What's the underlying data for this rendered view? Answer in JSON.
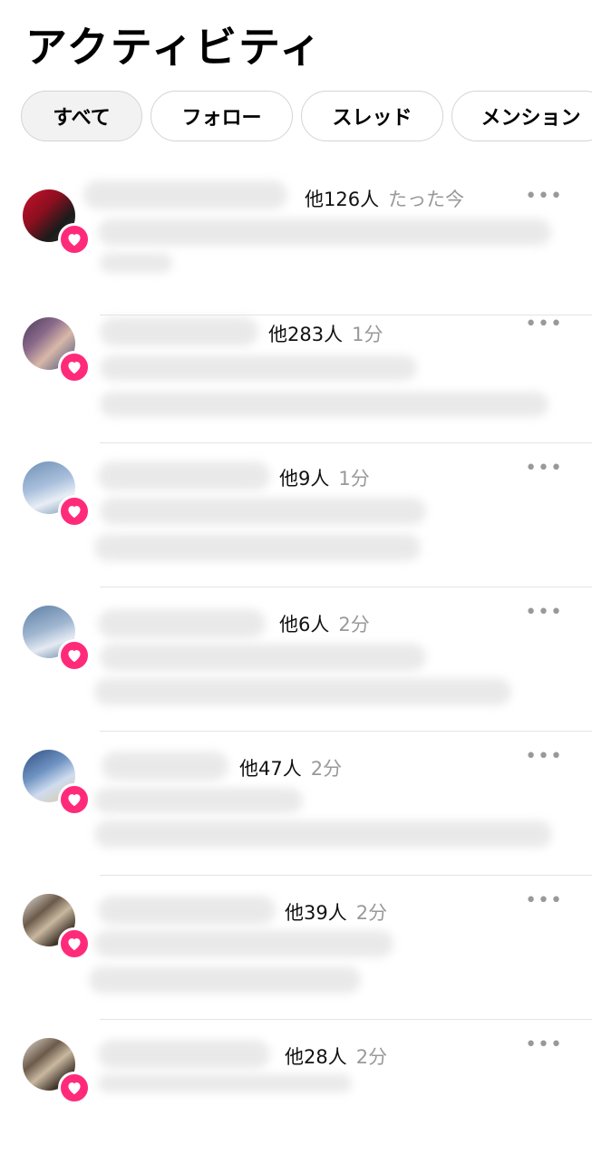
{
  "title": "アクティビティ",
  "tabs": [
    {
      "label": "すべて",
      "active": true
    },
    {
      "label": "フォロー",
      "active": false
    },
    {
      "label": "スレッド",
      "active": false
    },
    {
      "label": "メンション",
      "active": false
    }
  ],
  "notifications": [
    {
      "others": "他126人",
      "time": "たった今",
      "icon": "heart-icon"
    },
    {
      "others": "他283人",
      "time": "1分",
      "icon": "heart-icon"
    },
    {
      "others": "他9人",
      "time": "1分",
      "icon": "heart-icon"
    },
    {
      "others": "他6人",
      "time": "2分",
      "icon": "heart-icon"
    },
    {
      "others": "他47人",
      "time": "2分",
      "icon": "heart-icon"
    },
    {
      "others": "他39人",
      "time": "2分",
      "icon": "heart-icon"
    },
    {
      "others": "他28人",
      "time": "2分",
      "icon": "heart-icon"
    }
  ],
  "more_label": "•••",
  "colors": {
    "badge": "#ff2a7a",
    "muted": "#999999"
  }
}
